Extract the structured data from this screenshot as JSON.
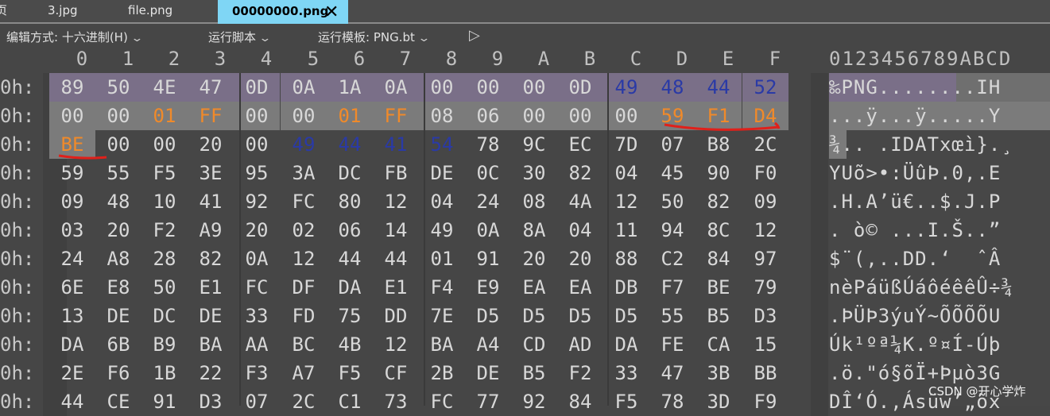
{
  "tabs": [
    {
      "label": "页",
      "active": false
    },
    {
      "label": "3.jpg",
      "active": false
    },
    {
      "label": "file.png",
      "active": false
    },
    {
      "label": "00000000.png",
      "active": true
    }
  ],
  "toolbar": {
    "edit_mode": "编辑方式: 十六进制(H)",
    "run_script": "运行脚本",
    "run_template": "运行模板: PNG.bt"
  },
  "column_headers": [
    "0",
    "1",
    "2",
    "3",
    "4",
    "5",
    "6",
    "7",
    "8",
    "9",
    "A",
    "B",
    "C",
    "D",
    "E",
    "F"
  ],
  "ascii_header": "0123456789ABCD",
  "rows": [
    {
      "offset": "0h:",
      "bytes": [
        "89",
        "50",
        "4E",
        "47",
        "0D",
        "0A",
        "1A",
        "0A",
        "00",
        "00",
        "00",
        "0D",
        "49",
        "48",
        "44",
        "52"
      ],
      "ascii": "‰PNG........IH"
    },
    {
      "offset": "0h:",
      "bytes": [
        "00",
        "00",
        "01",
        "FF",
        "00",
        "00",
        "01",
        "FF",
        "08",
        "06",
        "00",
        "00",
        "00",
        "59",
        "F1",
        "D4"
      ],
      "ascii": "...ÿ...ÿ.....Y"
    },
    {
      "offset": "0h:",
      "bytes": [
        "BE",
        "00",
        "00",
        "20",
        "00",
        "49",
        "44",
        "41",
        "54",
        "78",
        "9C",
        "EC",
        "7D",
        "07",
        "B8",
        "2C"
      ],
      "ascii": "¾.. .IDATxœì}.¸"
    },
    {
      "offset": "0h:",
      "bytes": [
        "59",
        "55",
        "F5",
        "3E",
        "95",
        "3A",
        "DC",
        "FB",
        "DE",
        "0C",
        "30",
        "82",
        "04",
        "45",
        "90",
        "F0"
      ],
      "ascii": "YUõ>•:ÜûÞ.0‚.E"
    },
    {
      "offset": "0h:",
      "bytes": [
        "09",
        "48",
        "10",
        "41",
        "92",
        "FC",
        "80",
        "12",
        "04",
        "24",
        "08",
        "4A",
        "12",
        "50",
        "82",
        "09"
      ],
      "ascii": ".H.A’ü€..$.J.P"
    },
    {
      "offset": "0h:",
      "bytes": [
        "03",
        "20",
        "F2",
        "A9",
        "20",
        "02",
        "06",
        "14",
        "49",
        "0A",
        "8A",
        "04",
        "11",
        "94",
        "8C",
        "12"
      ],
      "ascii": ". ò© ...I.Š..”"
    },
    {
      "offset": "0h:",
      "bytes": [
        "24",
        "A8",
        "28",
        "82",
        "0A",
        "12",
        "44",
        "44",
        "01",
        "91",
        "20",
        "20",
        "88",
        "C2",
        "84",
        "97"
      ],
      "ascii": "$¨(‚..DD.‘  ˆÂ"
    },
    {
      "offset": "0h:",
      "bytes": [
        "6E",
        "E8",
        "50",
        "E1",
        "FC",
        "DF",
        "DA",
        "E1",
        "F4",
        "E9",
        "EA",
        "EA",
        "DB",
        "F7",
        "BE",
        "79"
      ],
      "ascii": "nèPáüßÚáôéêêÛ÷¾"
    },
    {
      "offset": "0h:",
      "bytes": [
        "13",
        "DE",
        "DC",
        "DE",
        "33",
        "FD",
        "75",
        "DD",
        "7E",
        "D5",
        "D5",
        "D5",
        "D5",
        "55",
        "B5",
        "D3"
      ],
      "ascii": ".ÞÜÞ3ýuÝ~ÕÕÕÕU"
    },
    {
      "offset": "0h:",
      "bytes": [
        "DA",
        "6B",
        "B9",
        "BA",
        "AA",
        "BC",
        "4B",
        "12",
        "BA",
        "A4",
        "CD",
        "AD",
        "DA",
        "FE",
        "CA",
        "15"
      ],
      "ascii": "Úk¹ºª¼K.º¤Í-Úþ"
    },
    {
      "offset": "0h:",
      "bytes": [
        "2E",
        "F6",
        "1B",
        "22",
        "F3",
        "A7",
        "F5",
        "CF",
        "2B",
        "DE",
        "B5",
        "F2",
        "33",
        "47",
        "3B",
        "BB"
      ],
      "ascii": ".ö.\"ó§õÏ+Þµò3G"
    },
    {
      "offset": "0h:",
      "bytes": [
        "44",
        "CE",
        "91",
        "D3",
        "07",
        "2C",
        "C1",
        "73",
        "FC",
        "77",
        "92",
        "84",
        "F5",
        "78",
        "3D",
        "F9"
      ],
      "ascii": "DÎ‘Ó.,Ásüw’„õx"
    }
  ],
  "colors": {
    "orange": "#f08a2a",
    "blue": "#2a3aa6",
    "annotation": "#e0201a",
    "highlight_purple": "#7a6f88",
    "highlight_gray": "#7b7b7b",
    "tab_active": "#7fd6f5"
  },
  "watermark": "CSDN @开心学炸",
  "icons": {
    "tab_close": "close-icon",
    "dropdown": "chevron-down-icon",
    "play": "play-icon"
  }
}
